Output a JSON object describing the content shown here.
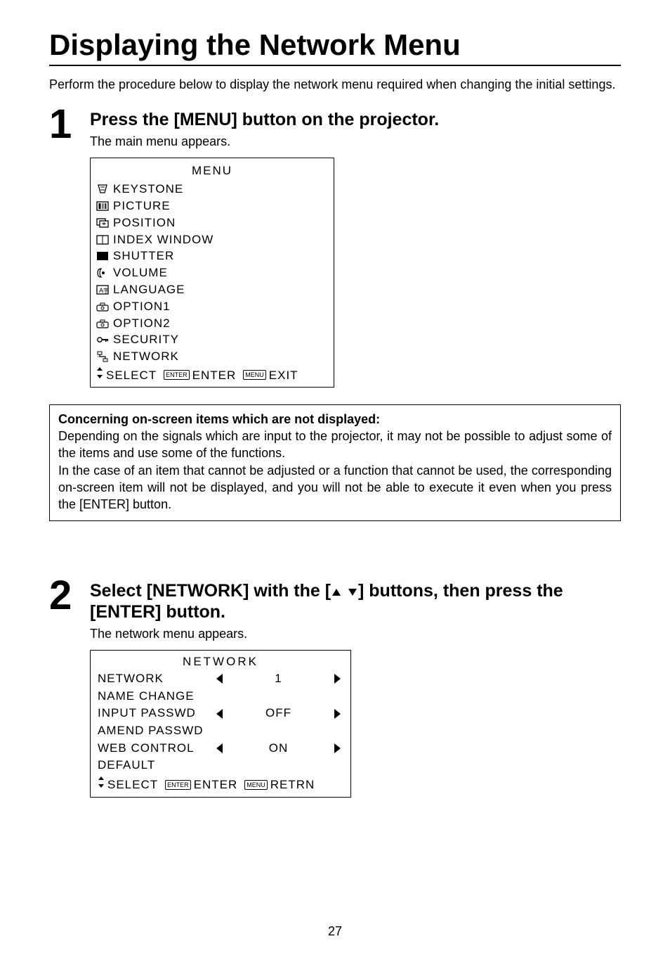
{
  "title": "Displaying the Network Menu",
  "intro": "Perform the procedure below to display the network menu required when changing the initial settings.",
  "step1": {
    "num": "1",
    "heading": "Press the [MENU] button on the projector.",
    "sub": "The main menu appears.",
    "osd": {
      "title": "MENU",
      "items": [
        "KEYSTONE",
        "PICTURE",
        "POSITION",
        "INDEX WINDOW",
        "SHUTTER",
        "VOLUME",
        "LANGUAGE",
        "OPTION1",
        "OPTION2",
        "SECURITY",
        "NETWORK"
      ],
      "footer_select": "SELECT",
      "footer_enter_btn": "ENTER",
      "footer_enter": "ENTER",
      "footer_menu_btn": "MENU",
      "footer_exit": "EXIT"
    }
  },
  "note": {
    "title": "Concerning on-screen items which are not displayed:",
    "l1": "Depending on the signals which are input to the projector, it may not be possible to adjust some of the items and use some of the functions.",
    "l2": "In the case of an item that cannot be adjusted or a function that cannot be used, the corresponding on-screen item will not be displayed, and you will not be able to execute it even when you press the [ENTER] button."
  },
  "step2": {
    "num": "2",
    "heading_pre": "Select [NETWORK] with the [",
    "heading_post": "] buttons, then press the [ENTER] button.",
    "sub": "The network menu appears.",
    "osd": {
      "title": "NETWORK",
      "rows": [
        {
          "label": "NETWORK",
          "value": "1",
          "arrows": true
        },
        {
          "label": "NAME CHANGE",
          "value": "",
          "arrows": false
        },
        {
          "label": "INPUT PASSWD",
          "value": "OFF",
          "arrows": true
        },
        {
          "label": "AMEND PASSWD",
          "value": "",
          "arrows": false
        },
        {
          "label": "WEB CONTROL",
          "value": "ON",
          "arrows": true
        },
        {
          "label": "DEFAULT",
          "value": "",
          "arrows": false
        }
      ],
      "footer_select": "SELECT",
      "footer_enter_btn": "ENTER",
      "footer_enter": "ENTER",
      "footer_menu_btn": "MENU",
      "footer_retrn": "RETRN"
    }
  },
  "page_number": "27"
}
